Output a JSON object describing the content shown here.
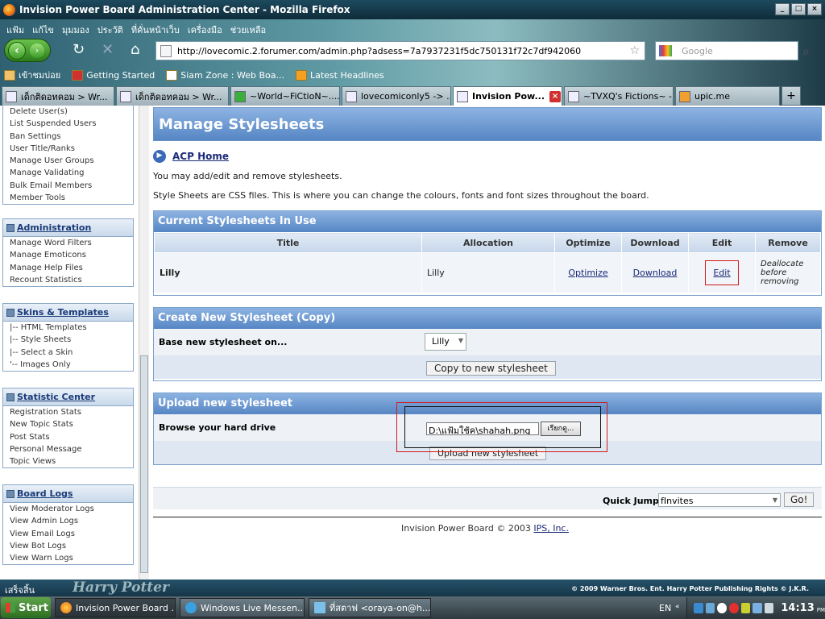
{
  "window": {
    "title": "Invision Power Board Administration Center - Mozilla Firefox",
    "min": "_",
    "max": "□",
    "close": "×"
  },
  "menu": [
    "แฟ้ม",
    "แก้ไข",
    "มุมมอง",
    "ประวัติ",
    "ที่คั่นหน้าเว็บ",
    "เครื่องมือ",
    "ช่วยเหลือ"
  ],
  "nav": {
    "url": "http://lovecomic.2.forumer.com/admin.php?adsess=7a7937231f5dc750131f72c7df942060",
    "search_placeholder": "Google"
  },
  "bookmarks": [
    "เข้าชมบ่อย",
    "Getting Started",
    "Siam Zone : Web Boa...",
    "Latest Headlines"
  ],
  "tabs": [
    {
      "label": "เด็กติดอทคอม > Wr..."
    },
    {
      "label": "เด็กติดอทคอม > Wr..."
    },
    {
      "label": "~World~FiCtioN~....."
    },
    {
      "label": "lovecomiconly5 -> ..."
    },
    {
      "label": "Invision Pow..."
    },
    {
      "label": "~TVXQ's Fictions~ -..."
    },
    {
      "label": "upic.me"
    }
  ],
  "sidebar": {
    "group1": [
      "Delete User(s)",
      "List Suspended Users",
      "Ban Settings",
      "User Title/Ranks",
      "Manage User Groups",
      "Manage Validating",
      "Bulk Email Members",
      "Member Tools"
    ],
    "admin": {
      "title": "Administration",
      "items": [
        "Manage Word Filters",
        "Manage Emoticons",
        "Manage Help Files",
        "Recount Statistics"
      ]
    },
    "skins": {
      "title": "Skins & Templates",
      "items": [
        "|-- HTML Templates",
        "|-- Style Sheets",
        "|-- Select a Skin",
        "'-- Images Only"
      ]
    },
    "stats": {
      "title": "Statistic Center",
      "items": [
        "Registration Stats",
        "New Topic Stats",
        "Post Stats",
        "Personal Message",
        "Topic Views"
      ]
    },
    "logs": {
      "title": "Board Logs",
      "items": [
        "View Moderator Logs",
        "View Admin Logs",
        "View Email Logs",
        "View Bot Logs",
        "View Warn Logs"
      ]
    }
  },
  "main": {
    "title": "Manage Stylesheets",
    "acp_home": "ACP Home",
    "desc1": "You may add/edit and remove stylesheets.",
    "desc2": "Style Sheets are CSS files. This is where you can change the colours, fonts and font sizes throughout the board.",
    "current": {
      "title": "Current Stylesheets In Use",
      "headers": [
        "Title",
        "Allocation",
        "Optimize",
        "Download",
        "Edit",
        "Remove"
      ],
      "row": {
        "title": "Lilly",
        "allocation": "Lilly",
        "optimize": "Optimize",
        "download": "Download",
        "edit": "Edit",
        "remove": "Deallocate before removing"
      }
    },
    "create": {
      "title": "Create New Stylesheet (Copy)",
      "label": "Base new stylesheet on...",
      "select": "Lilly",
      "button": "Copy to new stylesheet"
    },
    "upload": {
      "title": "Upload new stylesheet",
      "label": "Browse your hard drive",
      "file": "D:\\แฟ้มใช้ค\\shahah.png",
      "browse": "เรียกดู...",
      "button": "Upload new stylesheet"
    },
    "quickjump": {
      "label": "Quick Jump",
      "value": "fInvites",
      "go": "Go!"
    },
    "copyright": "Invision Power Board © 2003 ",
    "ips": "IPS, Inc."
  },
  "status": {
    "text": "เสร็จสิ้น",
    "banner": "Harry Potter",
    "copyright": "© 2009 Warner Bros. Ent. Harry Potter Publishing Rights © J.K.R."
  },
  "taskbar": {
    "start": "Start",
    "items": [
      "Invision Power Board ...",
      "Windows Live Messen...",
      "ที่สตาฟ <oraya-on@h..."
    ],
    "lang": "EN",
    "time": "14:13",
    "ampm": "PM"
  }
}
